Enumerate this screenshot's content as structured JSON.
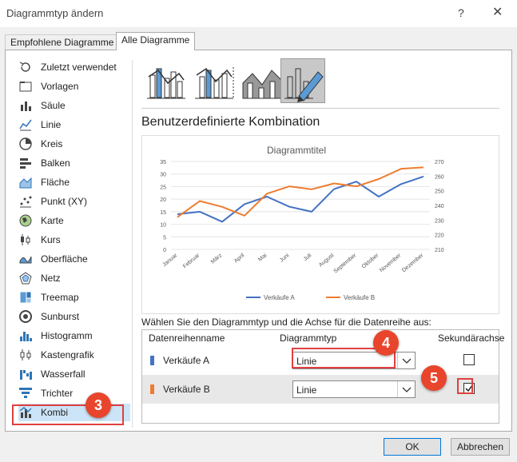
{
  "window": {
    "title": "Diagrammtyp ändern",
    "help": "?",
    "close": "✕"
  },
  "tabs": [
    {
      "label": "Empfohlene Diagramme"
    },
    {
      "label": "Alle Diagramme"
    }
  ],
  "sidebar": {
    "items": [
      {
        "label": "Zuletzt verwendet",
        "icon": "recent-icon"
      },
      {
        "label": "Vorlagen",
        "icon": "folder-icon"
      },
      {
        "label": "Säule",
        "icon": "column-chart-icon"
      },
      {
        "label": "Linie",
        "icon": "line-chart-icon"
      },
      {
        "label": "Kreis",
        "icon": "pie-chart-icon"
      },
      {
        "label": "Balken",
        "icon": "bar-chart-icon"
      },
      {
        "label": "Fläche",
        "icon": "area-chart-icon"
      },
      {
        "label": "Punkt (XY)",
        "icon": "scatter-chart-icon"
      },
      {
        "label": "Karte",
        "icon": "map-chart-icon"
      },
      {
        "label": "Kurs",
        "icon": "stock-chart-icon"
      },
      {
        "label": "Oberfläche",
        "icon": "surface-chart-icon"
      },
      {
        "label": "Netz",
        "icon": "radar-chart-icon"
      },
      {
        "label": "Treemap",
        "icon": "treemap-icon"
      },
      {
        "label": "Sunburst",
        "icon": "sunburst-icon"
      },
      {
        "label": "Histogramm",
        "icon": "histogram-icon"
      },
      {
        "label": "Kastengrafik",
        "icon": "box-whisker-icon"
      },
      {
        "label": "Wasserfall",
        "icon": "waterfall-icon"
      },
      {
        "label": "Trichter",
        "icon": "funnel-icon"
      },
      {
        "label": "Kombi",
        "icon": "combo-chart-icon",
        "selected": true
      }
    ]
  },
  "main": {
    "combo_title": "Benutzerdefinierte Kombination",
    "series_prompt": "Wählen Sie den Diagrammtyp und die Achse für die Datenreihe aus:",
    "table": {
      "headers": [
        "Datenreihenname",
        "Diagrammtyp",
        "Sekundärachse"
      ],
      "rows": [
        {
          "name": "Verkäufe A",
          "type": "Linie",
          "secondary": false,
          "color": "#4472c4"
        },
        {
          "name": "Verkäufe B",
          "type": "Linie",
          "secondary": true,
          "color": "#ed7d31"
        }
      ]
    }
  },
  "chart_data": {
    "type": "line",
    "title": "Diagrammtitel",
    "categories": [
      "Januar",
      "Februar",
      "März",
      "April",
      "Mai",
      "Juni",
      "Juli",
      "August",
      "September",
      "Oktober",
      "November",
      "Dezember"
    ],
    "series": [
      {
        "name": "Verkäufe A",
        "axis": "primary",
        "color": "#4472c4",
        "values": [
          14,
          15,
          11,
          18,
          21,
          17,
          15,
          24,
          27,
          21,
          26,
          29
        ]
      },
      {
        "name": "Verkäufe B",
        "axis": "secondary",
        "color": "#ed7d31",
        "values": [
          232,
          243,
          239,
          233,
          248,
          253,
          251,
          255,
          253,
          258,
          265,
          266
        ]
      }
    ],
    "y_left": {
      "min": 0,
      "max": 35,
      "ticks": [
        "0",
        "5",
        "10",
        "15",
        "20",
        "25",
        "30",
        "35"
      ]
    },
    "y_right": {
      "min": 210,
      "max": 270,
      "ticks": [
        "210",
        "220",
        "230",
        "240",
        "250",
        "260",
        "270"
      ]
    },
    "legend_position": "bottom"
  },
  "annotations": {
    "badge3": "3",
    "badge4": "4",
    "badge5": "5"
  },
  "buttons": {
    "ok": "OK",
    "cancel": "Abbrechen"
  },
  "colors": {
    "accent": "#0078d7",
    "annotation_red": "#e8452c",
    "series_a": "#4472c4",
    "series_b": "#ed7d31"
  }
}
